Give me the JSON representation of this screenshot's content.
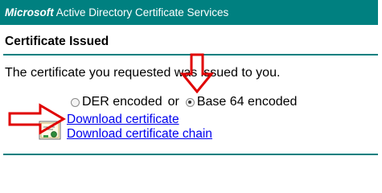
{
  "header": {
    "brand": "Microsoft",
    "title": " Active Directory Certificate Services"
  },
  "page": {
    "title": "Certificate Issued",
    "message": "The certificate you requested was issued to you."
  },
  "format": {
    "der_label": "DER encoded",
    "separator": "or",
    "base64_label": "Base 64 encoded",
    "selected": "Base 64 encoded"
  },
  "links": {
    "download_certificate": "Download certificate",
    "download_chain": "Download certificate chain"
  },
  "icons": {
    "certificate": "certificate-icon",
    "annotation_down": "red-arrow-down-icon",
    "annotation_right": "red-arrow-right-icon"
  },
  "colors": {
    "accent": "#008080",
    "link": "#0000ee",
    "annotation": "#e00000"
  }
}
